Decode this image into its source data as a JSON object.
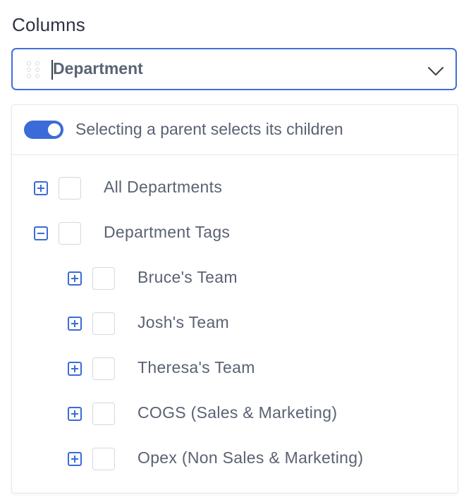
{
  "field": {
    "label": "Columns",
    "selected_value": "Department"
  },
  "dropdown": {
    "toggle_label": "Selecting a parent selects its children",
    "toggle_on": true,
    "accent_color": "#3a6bd8",
    "tree": [
      {
        "label": "All Departments",
        "expander": "plus-square-icon",
        "checked": false,
        "level": 0
      },
      {
        "label": "Department Tags",
        "expander": "minus-square-icon",
        "checked": false,
        "level": 0
      },
      {
        "label": "Bruce's Team",
        "expander": "plus-square-icon",
        "checked": false,
        "level": 1
      },
      {
        "label": "Josh's Team",
        "expander": "plus-square-icon",
        "checked": false,
        "level": 1
      },
      {
        "label": "Theresa's Team",
        "expander": "plus-square-icon",
        "checked": false,
        "level": 1
      },
      {
        "label": "COGS (Sales & Marketing)",
        "expander": "plus-square-icon",
        "checked": false,
        "level": 1
      },
      {
        "label": "Opex (Non Sales & Marketing)",
        "expander": "plus-square-icon",
        "checked": false,
        "level": 1
      }
    ]
  }
}
